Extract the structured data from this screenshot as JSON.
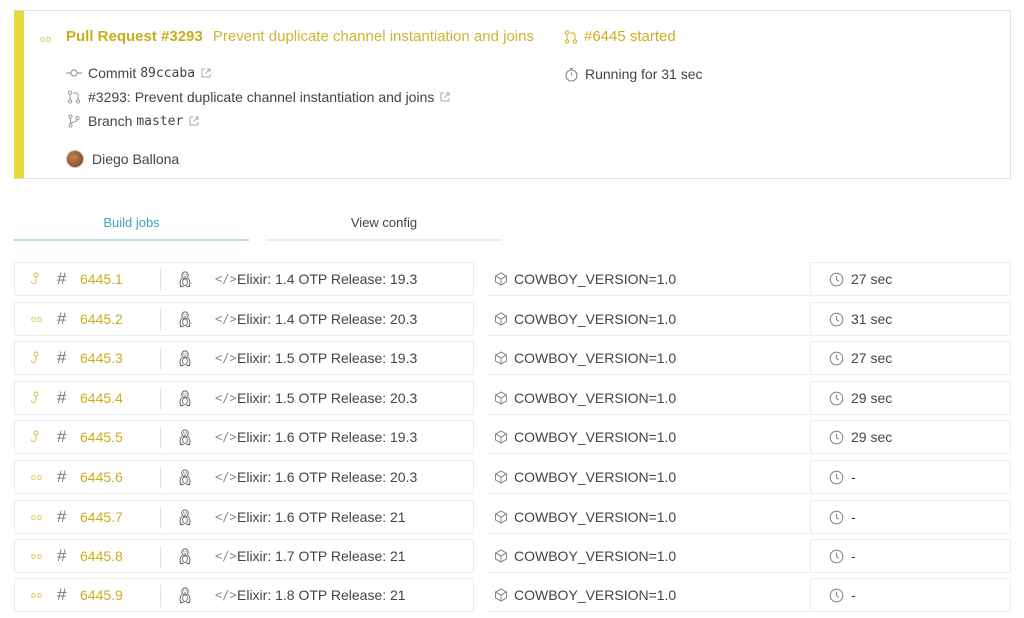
{
  "header": {
    "pr_label": "Pull Request #3293",
    "pr_message": "Prevent duplicate channel instantiation and joins",
    "commit_label": "Commit",
    "commit_hash": "89ccaba",
    "pr_link": "#3293: Prevent duplicate channel instantiation and joins",
    "branch_label": "Branch",
    "branch_name": "master",
    "author": "Diego Ballona",
    "build_status": "#6445 started",
    "running": "Running for 31 sec",
    "accent_color": "#e8d93f"
  },
  "tabs": {
    "build_jobs": "Build jobs",
    "view_config": "View config"
  },
  "jobs": [
    {
      "state": "running-icon",
      "number": "6445.1",
      "lang": "Elixir: 1.4 OTP Release: 19.3",
      "env": "COWBOY_VERSION=1.0",
      "duration": "27 sec"
    },
    {
      "state": "queued-icon",
      "number": "6445.2",
      "lang": "Elixir: 1.4 OTP Release: 20.3",
      "env": "COWBOY_VERSION=1.0",
      "duration": "31 sec"
    },
    {
      "state": "running-icon",
      "number": "6445.3",
      "lang": "Elixir: 1.5 OTP Release: 19.3",
      "env": "COWBOY_VERSION=1.0",
      "duration": "27 sec"
    },
    {
      "state": "running-icon",
      "number": "6445.4",
      "lang": "Elixir: 1.5 OTP Release: 20.3",
      "env": "COWBOY_VERSION=1.0",
      "duration": "29 sec"
    },
    {
      "state": "running-icon",
      "number": "6445.5",
      "lang": "Elixir: 1.6 OTP Release: 19.3",
      "env": "COWBOY_VERSION=1.0",
      "duration": "29 sec"
    },
    {
      "state": "queued-icon",
      "number": "6445.6",
      "lang": "Elixir: 1.6 OTP Release: 20.3",
      "env": "COWBOY_VERSION=1.0",
      "duration": "-"
    },
    {
      "state": "queued-icon",
      "number": "6445.7",
      "lang": "Elixir: 1.6 OTP Release: 21",
      "env": "COWBOY_VERSION=1.0",
      "duration": "-"
    },
    {
      "state": "queued-icon",
      "number": "6445.8",
      "lang": "Elixir: 1.7 OTP Release: 21",
      "env": "COWBOY_VERSION=1.0",
      "duration": "-"
    },
    {
      "state": "queued-icon",
      "number": "6445.9",
      "lang": "Elixir: 1.8 OTP Release: 21",
      "env": "COWBOY_VERSION=1.0",
      "duration": "-"
    }
  ]
}
